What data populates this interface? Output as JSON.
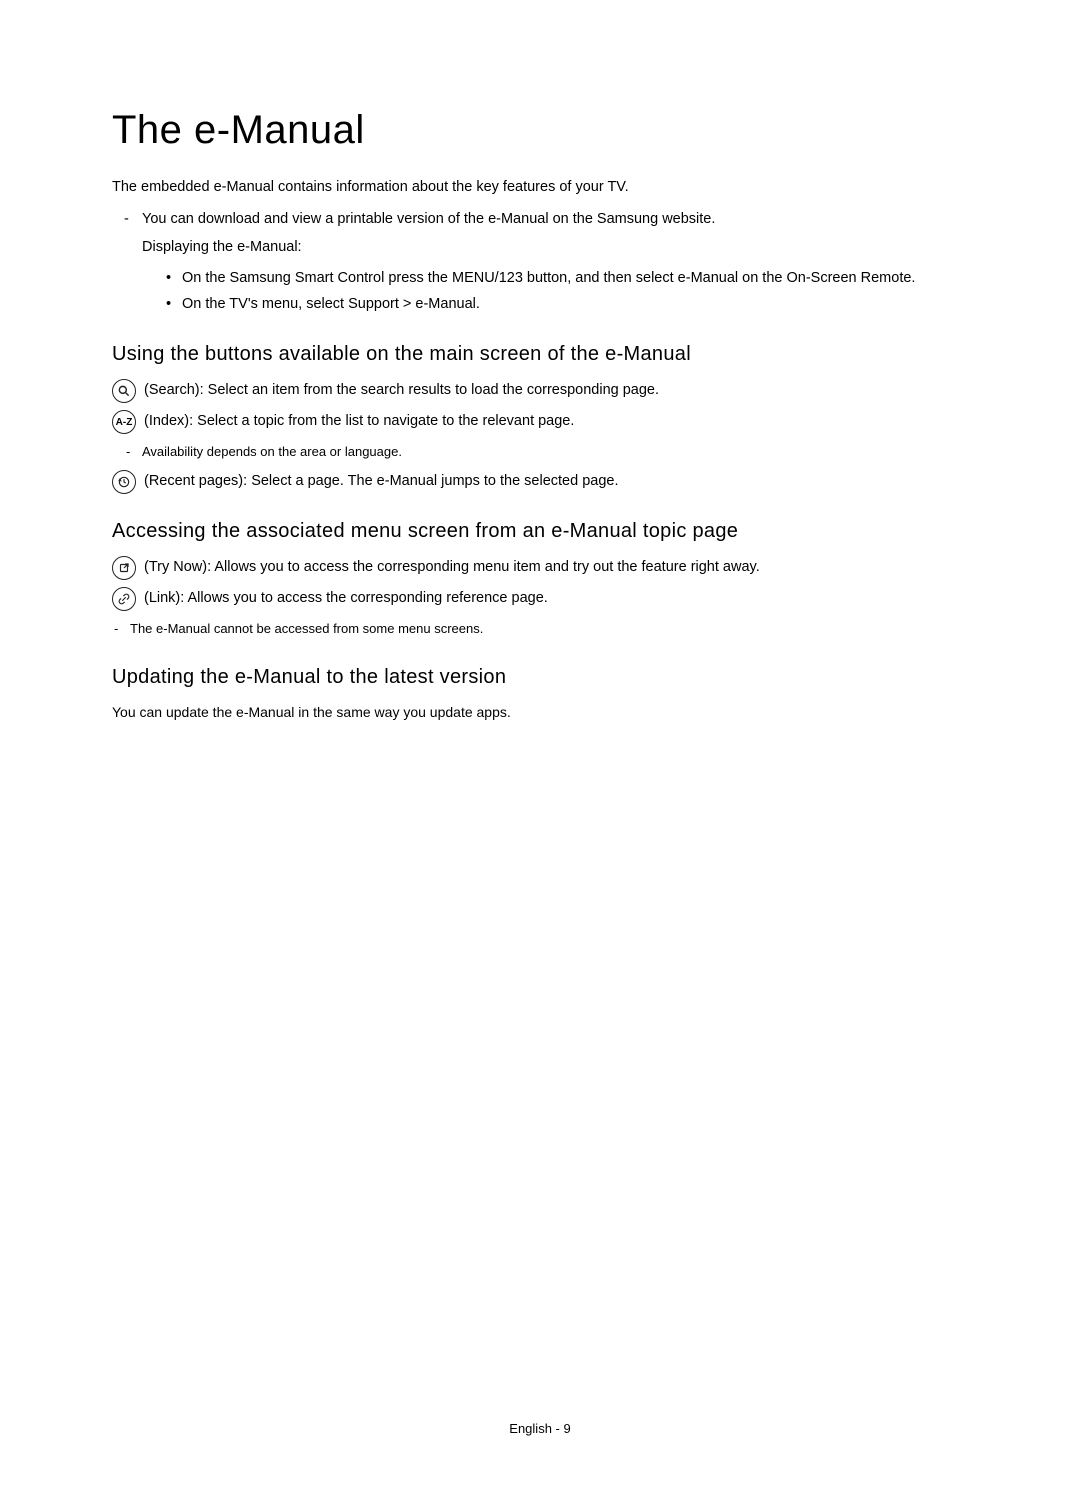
{
  "title": "The e-Manual",
  "intro": "The embedded e-Manual contains information about the key features of your TV.",
  "top_list": {
    "download": "You can download and view a printable version of the e-Manual on the Samsung website.",
    "displaying": "Displaying the e-Manual:",
    "display_items": {
      "a": "On the Samsung Smart Control press the MENU/123 button, and then select e-Manual on the On-Screen Remote.",
      "b": "On the TV's menu, select Support > e-Manual."
    }
  },
  "section1": {
    "heading": "Using the buttons available on the main screen of the e-Manual",
    "search": "(Search): Select an item from the search results to load the corresponding page.",
    "index": "(Index): Select a topic from the list to navigate to the relevant page.",
    "index_label": "A-Z",
    "avail_note": "Availability depends on the area or language.",
    "recent": "(Recent pages): Select a page. The e-Manual jumps to the selected page."
  },
  "section2": {
    "heading": "Accessing the associated menu screen from an e-Manual topic page",
    "trynow": "(Try Now): Allows you to access the corresponding menu item and try out the feature right away.",
    "link": "(Link): Allows you to access the corresponding reference page.",
    "note": "The e-Manual cannot be accessed from some menu screens."
  },
  "section3": {
    "heading": "Updating the e-Manual to the latest version",
    "body": "You can update the e-Manual in the same way you update apps."
  },
  "footer": "English - 9"
}
